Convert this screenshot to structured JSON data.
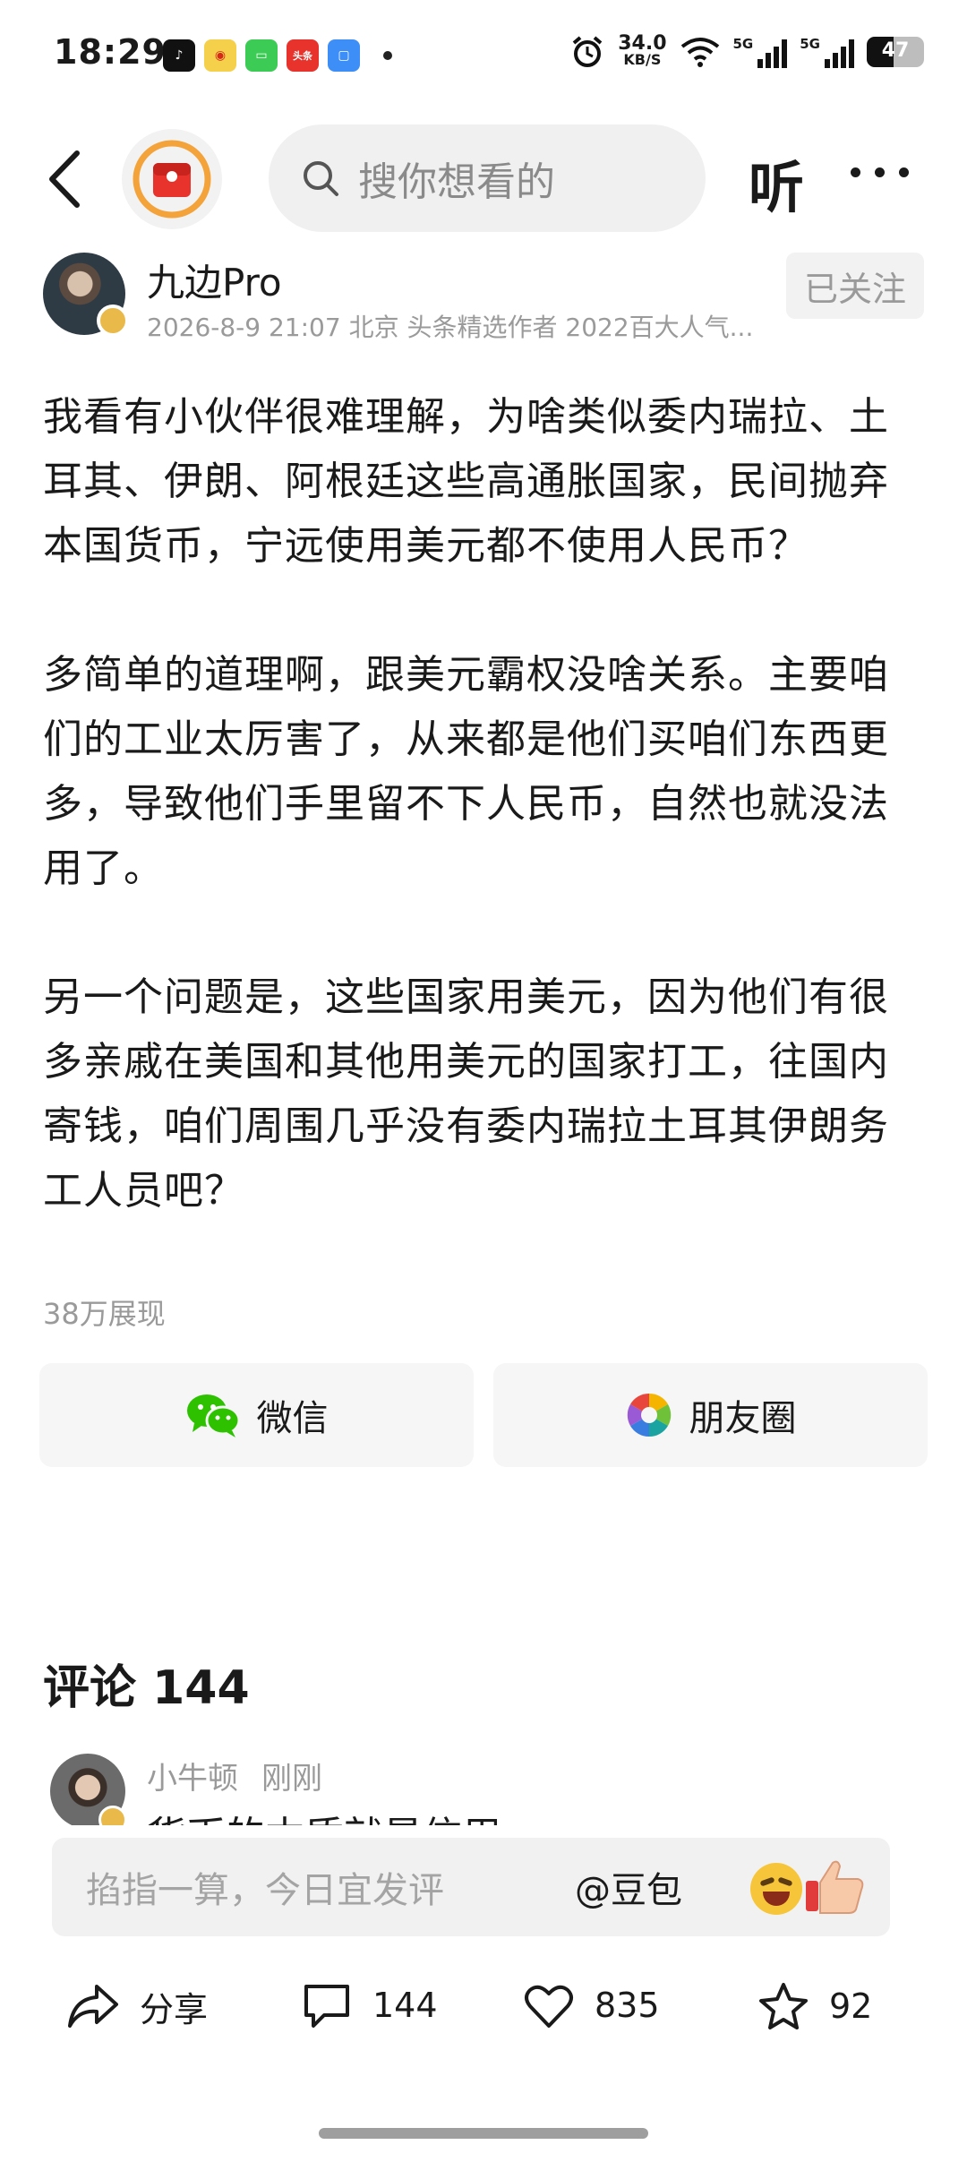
{
  "status_bar": {
    "time": "18:29",
    "net_speed_value": "34.0",
    "net_speed_unit": "KB/S",
    "signal_1_label": "5G",
    "signal_2_label": "5G",
    "battery_level": "47",
    "app_icons": [
      "douyin-icon",
      "weibo-icon",
      "messages-icon",
      "toutiao-icon",
      "app-store-icon"
    ]
  },
  "nav": {
    "search_placeholder": "搜你想看的",
    "listen_label": "听"
  },
  "author": {
    "name": "九边Pro",
    "meta": "2026-8-9 21:07  北京  头条精选作者 2022百大人气...",
    "follow_label": "已关注"
  },
  "article": {
    "paragraphs": [
      "我看有小伙伴很难理解，为啥类似委内瑞拉、土耳其、伊朗、阿根廷这些高通胀国家，民间抛弃本国货币，宁远使用美元都不使用人民币？",
      "多简单的道理啊，跟美元霸权没啥关系。主要咱们的工业太厉害了，从来都是他们买咱们东西更多，导致他们手里留不下人民币，自然也就没法用了。",
      "另一个问题是，这些国家用美元，因为他们有很多亲戚在美国和其他用美元的国家打工，往国内寄钱，咱们周围几乎没有委内瑞拉土耳其伊朗务工人员吧？"
    ],
    "views": "38万展现"
  },
  "share": {
    "wechat_label": "微信",
    "moments_label": "朋友圈"
  },
  "comments": {
    "title": "评论 144",
    "first": {
      "user": "小牛顿",
      "time": "刚刚",
      "text": "货币的本质就是信用"
    }
  },
  "comment_input": {
    "placeholder": "掐指一算，今日宜发评",
    "mention_label": "@豆包"
  },
  "actions": {
    "share_label": "分享",
    "comment_count": "144",
    "like_count": "835",
    "favorite_count": "92"
  },
  "colors": {
    "brand_red": "#e8322c",
    "wechat_green": "#2dc100",
    "muted_text": "#9a9a9a"
  }
}
